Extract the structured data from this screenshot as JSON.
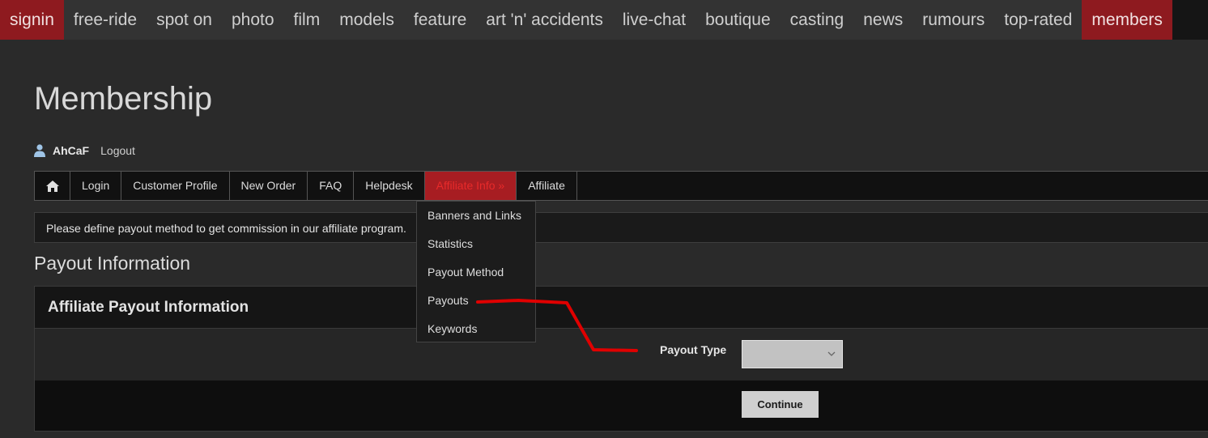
{
  "top_nav": {
    "items": [
      "signin",
      "free-ride",
      "spot on",
      "photo",
      "film",
      "models",
      "feature",
      "art 'n' accidents",
      "live-chat",
      "boutique",
      "casting",
      "news",
      "rumours",
      "top-rated",
      "members"
    ]
  },
  "page": {
    "title": "Membership"
  },
  "user": {
    "name": "AhCaF",
    "logout": "Logout"
  },
  "sub_nav": {
    "items": [
      "Login",
      "Customer Profile",
      "New Order",
      "FAQ",
      "Helpdesk",
      "Affiliate Info",
      "Affiliate"
    ],
    "active_suffix": " »"
  },
  "dropdown": {
    "items": [
      "Banners and Links",
      "Statistics",
      "Payout Method",
      "Payouts",
      "Keywords"
    ]
  },
  "notice": "Please define payout method to get commission in our affiliate program.",
  "section_title": "Payout Information",
  "panel": {
    "title": "Affiliate Payout Information",
    "payout_type_label": "Payout Type",
    "payout_type_value": "",
    "continue_label": "Continue"
  },
  "colors": {
    "accent_red": "#a71d22",
    "annotation_red": "#e00000"
  }
}
